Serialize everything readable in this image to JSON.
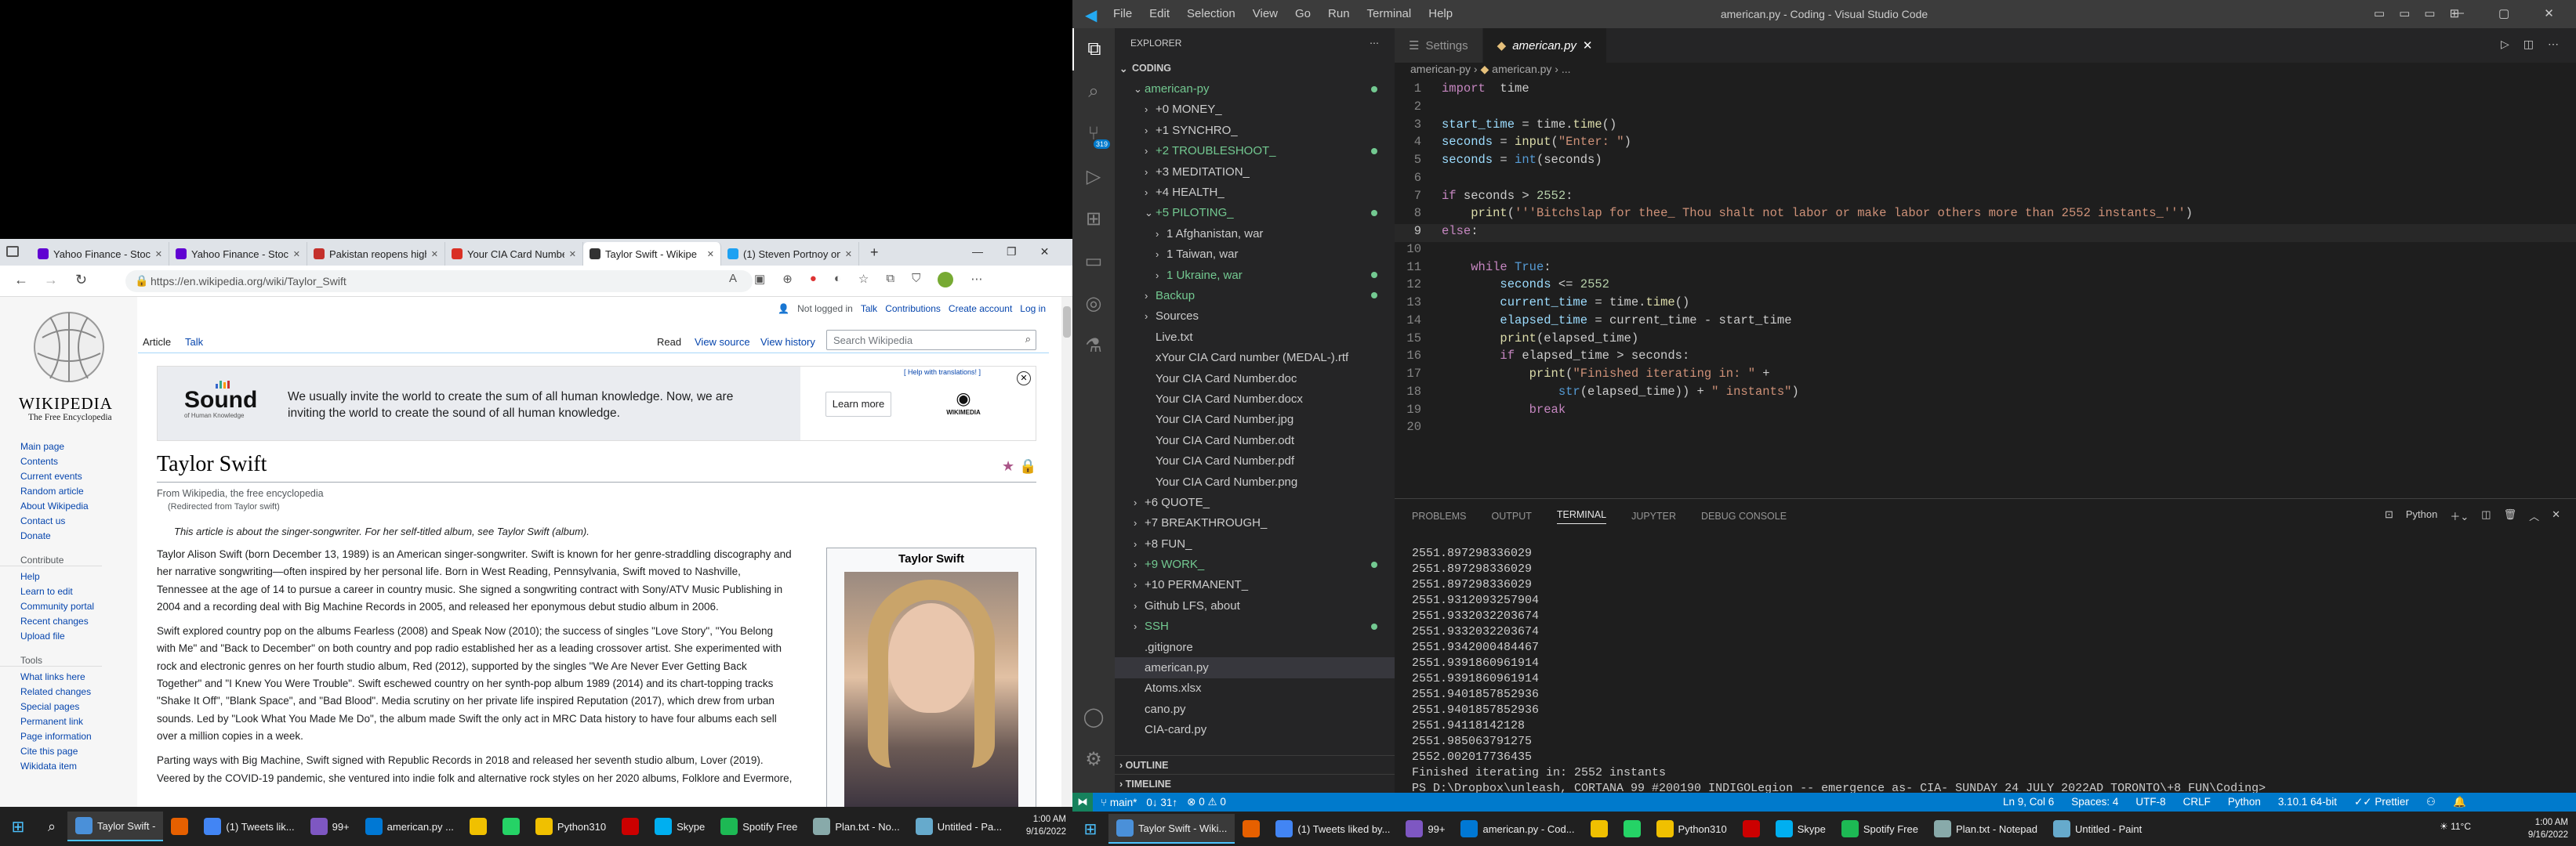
{
  "browser": {
    "tabs": [
      {
        "label": "Yahoo Finance - Stock",
        "color": "#6001d2"
      },
      {
        "label": "Yahoo Finance - Stock",
        "color": "#6001d2"
      },
      {
        "label": "Pakistan reopens high",
        "color": "#c4302b"
      },
      {
        "label": "Your CIA Card Number",
        "color": "#d93025"
      },
      {
        "label": "Taylor Swift - Wikipe",
        "color": "#333333"
      },
      {
        "label": "(1) Steven Portnoy on",
        "color": "#1da1f2"
      }
    ],
    "url": "https://en.wikipedia.org/wiki/Taylor_Swift"
  },
  "wiki": {
    "logo_title": "Wikipedia",
    "logo_tagline": "The Free Encyclopedia",
    "nav_main": [
      "Main page",
      "Contents",
      "Current events",
      "Random article",
      "About Wikipedia",
      "Contact us",
      "Donate"
    ],
    "contribute_heading": "Contribute",
    "nav_contribute": [
      "Help",
      "Learn to edit",
      "Community portal",
      "Recent changes",
      "Upload file"
    ],
    "tools_heading": "Tools",
    "nav_tools": [
      "What links here",
      "Related changes",
      "Special pages",
      "Permanent link",
      "Page information",
      "Cite this page",
      "Wikidata item"
    ],
    "user_links": {
      "not_logged": "Not logged in",
      "talk": "Talk",
      "contributions": "Contributions",
      "create": "Create account",
      "login": "Log in"
    },
    "tab_article": "Article",
    "tab_talk": "Talk",
    "tab_read": "Read",
    "tab_view_source": "View source",
    "tab_history": "View history",
    "search_placeholder": "Search Wikipedia",
    "banner": {
      "sound": "Sound",
      "sound_sub": "of Human Knowledge",
      "text": "We usually invite the world to create the sum of all human knowledge. Now, we are inviting the world to create the sound of all human knowledge.",
      "help_link": "[ Help with translations! ]",
      "learn_more": "Learn more",
      "wm": "WIKIMEDIA"
    },
    "title": "Taylor Swift",
    "from": "From Wikipedia, the free encyclopedia",
    "redirected": "(Redirected from Taylor swift)",
    "hatnote": "This article is about the singer-songwriter. For her self-titled album, see Taylor Swift (album).",
    "p1": "Taylor Alison Swift (born December 13, 1989) is an American singer-songwriter. Swift is known for her genre-straddling discography and her narrative songwriting—often inspired by her personal life. Born in West Reading, Pennsylvania, Swift moved to Nashville, Tennessee at the age of 14 to pursue a career in country music. She signed a songwriting contract with Sony/ATV Music Publishing in 2004 and a recording deal with Big Machine Records in 2005, and released her eponymous debut studio album in 2006.",
    "p2": "Swift explored country pop on the albums Fearless (2008) and Speak Now (2010); the success of singles \"Love Story\", \"You Belong with Me\" and \"Back to December\" on both country and pop radio established her as a leading crossover artist. She experimented with rock and electronic genres on her fourth studio album, Red (2012), supported by the singles \"We Are Never Ever Getting Back Together\" and \"I Knew You Were Trouble\". Swift eschewed country on her synth-pop album 1989 (2014) and its chart-topping tracks \"Shake It Off\", \"Blank Space\", and \"Bad Blood\". Media scrutiny on her private life inspired Reputation (2017), which drew from urban sounds. Led by \"Look What You Made Me Do\", the album made Swift the only act in MRC Data history to have four albums each sell over a million copies in a week.",
    "p3": "Parting ways with Big Machine, Swift signed with Republic Records in 2018 and released her seventh studio album, Lover (2019). Veered by the COVID-19 pandemic, she ventured into indie folk and alternative rock styles on her 2020 albums, Folklore and Evermore,",
    "infobox_title": "Taylor Swift"
  },
  "left_taskbar": [
    {
      "label": "Taylor Swift -",
      "color": "#4a90d9"
    },
    {
      "label": "",
      "color": "#e66000"
    },
    {
      "label": "(1) Tweets lik...",
      "color": "#4285f4"
    },
    {
      "label": "99+",
      "color": "#7e57c2"
    },
    {
      "label": "american.py ...",
      "color": "#0078d4"
    },
    {
      "label": "",
      "color": "#f0c000"
    },
    {
      "label": "",
      "color": "#25d366"
    },
    {
      "label": "Python310",
      "color": "#f0c000"
    },
    {
      "label": "",
      "color": "#cc0000"
    },
    {
      "label": "Skype",
      "color": "#00aff0"
    },
    {
      "label": "Spotify Free",
      "color": "#1db954"
    },
    {
      "label": "Plan.txt - No...",
      "color": "#8aa"
    },
    {
      "label": "Untitled - Pa...",
      "color": "#6ac"
    }
  ],
  "left_clock": {
    "time": "1:00 AM",
    "date": "9/16/2022"
  },
  "vscode": {
    "menu": [
      "File",
      "Edit",
      "Selection",
      "View",
      "Go",
      "Run",
      "Terminal",
      "Help"
    ],
    "title": "american.py - Coding - Visual Studio Code",
    "explorer_title": "EXPLORER",
    "workspace": "CODING",
    "tree": [
      {
        "label": "american-py",
        "indent": 1,
        "chev": "v",
        "color": "#73c991",
        "dot": "#73c991"
      },
      {
        "label": "+0 MONEY_",
        "indent": 2,
        "chev": ">",
        "color": "#cccccc"
      },
      {
        "label": "+1 SYNCHRO_",
        "indent": 2,
        "chev": ">",
        "color": "#cccccc"
      },
      {
        "label": "+2 TROUBLESHOOT_",
        "indent": 2,
        "chev": ">",
        "color": "#73c991",
        "dot": "#73c991"
      },
      {
        "label": "+3 MEDITATION_",
        "indent": 2,
        "chev": ">",
        "color": "#cccccc"
      },
      {
        "label": "+4 HEALTH_",
        "indent": 2,
        "chev": ">",
        "color": "#cccccc"
      },
      {
        "label": "+5 PILOTING_",
        "indent": 2,
        "chev": "v",
        "color": "#73c991",
        "dot": "#73c991"
      },
      {
        "label": "1 Afghanistan, war",
        "indent": 3,
        "chev": ">",
        "color": "#cccccc"
      },
      {
        "label": "1 Taiwan, war",
        "indent": 3,
        "chev": ">",
        "color": "#cccccc"
      },
      {
        "label": "1 Ukraine, war",
        "indent": 3,
        "chev": ">",
        "color": "#73c991",
        "dot": "#73c991"
      },
      {
        "label": "Backup",
        "indent": 2,
        "chev": ">",
        "color": "#73c991",
        "dot": "#73c991"
      },
      {
        "label": "Sources",
        "indent": 2,
        "chev": ">",
        "color": "#cccccc"
      },
      {
        "label": "Live.txt",
        "indent": 2,
        "chev": "",
        "color": "#cccccc"
      },
      {
        "label": "xYour CIA Card number (MEDAL-).rtf",
        "indent": 2,
        "chev": "",
        "color": "#cccccc"
      },
      {
        "label": "Your CIA Card Number.doc",
        "indent": 2,
        "chev": "",
        "color": "#cccccc"
      },
      {
        "label": "Your CIA Card Number.docx",
        "indent": 2,
        "chev": "",
        "color": "#cccccc"
      },
      {
        "label": "Your CIA Card Number.jpg",
        "indent": 2,
        "chev": "",
        "color": "#cccccc"
      },
      {
        "label": "Your CIA Card Number.odt",
        "indent": 2,
        "chev": "",
        "color": "#cccccc"
      },
      {
        "label": "Your CIA Card Number.pdf",
        "indent": 2,
        "chev": "",
        "color": "#cccccc"
      },
      {
        "label": "Your CIA Card Number.png",
        "indent": 2,
        "chev": "",
        "color": "#cccccc"
      },
      {
        "label": "+6 QUOTE_",
        "indent": 1,
        "chev": ">",
        "color": "#cccccc"
      },
      {
        "label": "+7 BREAKTHROUGH_",
        "indent": 1,
        "chev": ">",
        "color": "#cccccc"
      },
      {
        "label": "+8 FUN_",
        "indent": 1,
        "chev": ">",
        "color": "#cccccc"
      },
      {
        "label": "+9 WORK_",
        "indent": 1,
        "chev": ">",
        "color": "#73c991",
        "dot": "#73c991"
      },
      {
        "label": "+10 PERMANENT_",
        "indent": 1,
        "chev": ">",
        "color": "#cccccc"
      },
      {
        "label": "Github LFS, about",
        "indent": 1,
        "chev": ">",
        "color": "#cccccc"
      },
      {
        "label": "SSH",
        "indent": 1,
        "chev": ">",
        "color": "#73c991",
        "dot": "#73c991"
      },
      {
        "label": ".gitignore",
        "indent": 1,
        "chev": "",
        "color": "#cccccc"
      },
      {
        "label": "american.py",
        "indent": 1,
        "chev": "",
        "color": "#cccccc",
        "selected": true
      },
      {
        "label": "Atoms.xlsx",
        "indent": 1,
        "chev": "",
        "color": "#cccccc"
      },
      {
        "label": "cano.py",
        "indent": 1,
        "chev": "",
        "color": "#cccccc"
      },
      {
        "label": "CIA-card.py",
        "indent": 1,
        "chev": "",
        "color": "#cccccc"
      }
    ],
    "outline": "OUTLINE",
    "timeline": "TIMELINE",
    "tab_settings": "Settings",
    "tab_file": "american.py",
    "crumb_folder": "american-py",
    "crumb_file": "american.py",
    "crumb_more": "...",
    "code": [
      [
        [
          "kw",
          "import"
        ],
        [
          "",
          "  time"
        ]
      ],
      [],
      [
        [
          "var",
          "start_time"
        ],
        [
          "",
          " = time."
        ],
        [
          "fn",
          "time"
        ],
        [
          "",
          "()"
        ]
      ],
      [
        [
          "var",
          "seconds"
        ],
        [
          "",
          " = "
        ],
        [
          "fn",
          "input"
        ],
        [
          "",
          "("
        ],
        [
          "str",
          "\"Enter: \""
        ],
        [
          "",
          ")"
        ]
      ],
      [
        [
          "var",
          "seconds"
        ],
        [
          "",
          " = "
        ],
        [
          "bl",
          "int"
        ],
        [
          "",
          "(seconds)"
        ]
      ],
      [],
      [
        [
          "kw",
          "if"
        ],
        [
          "",
          " seconds > "
        ],
        [
          "num",
          "2552"
        ],
        [
          "",
          ":"
        ]
      ],
      [
        [
          "",
          "    "
        ],
        [
          "fn",
          "print"
        ],
        [
          "",
          "("
        ],
        [
          "str",
          "'''Bitchslap for thee_ Thou shalt not labor or make labor others more than 2552 instants_'''"
        ],
        [
          "",
          ")"
        ]
      ],
      [
        [
          "kw",
          "else"
        ],
        [
          "",
          ":"
        ]
      ],
      [],
      [
        [
          "",
          "    "
        ],
        [
          "kw",
          "while"
        ],
        [
          "",
          " "
        ],
        [
          "bl",
          "True"
        ],
        [
          "",
          ":"
        ]
      ],
      [
        [
          "",
          "        "
        ],
        [
          "var",
          "seconds"
        ],
        [
          "",
          " <= "
        ],
        [
          "num",
          "2552"
        ]
      ],
      [
        [
          "",
          "        "
        ],
        [
          "var",
          "current_time"
        ],
        [
          "",
          " = time."
        ],
        [
          "fn",
          "time"
        ],
        [
          "",
          "()"
        ]
      ],
      [
        [
          "",
          "        "
        ],
        [
          "var",
          "elapsed_time"
        ],
        [
          "",
          " = current_time - start_time"
        ]
      ],
      [
        [
          "",
          "        "
        ],
        [
          "fn",
          "print"
        ],
        [
          "",
          "(elapsed_time)"
        ]
      ],
      [
        [
          "",
          "        "
        ],
        [
          "kw",
          "if"
        ],
        [
          "",
          " elapsed_time > seconds:"
        ]
      ],
      [
        [
          "",
          "            "
        ],
        [
          "fn",
          "print"
        ],
        [
          "",
          "("
        ],
        [
          "str",
          "\"Finished iterating in: \""
        ],
        [
          "",
          " +"
        ]
      ],
      [
        [
          "",
          "                "
        ],
        [
          "bl",
          "str"
        ],
        [
          "",
          "(elapsed_time)) + "
        ],
        [
          "str",
          "\" instants\""
        ],
        [
          "",
          ")"
        ]
      ],
      [
        [
          "",
          "            "
        ],
        [
          "kw",
          "break"
        ]
      ],
      []
    ],
    "panel_tabs": [
      "PROBLEMS",
      "OUTPUT",
      "TERMINAL",
      "JUPYTER",
      "DEBUG CONSOLE"
    ],
    "terminal_lang": "Python",
    "terminal_lines": [
      "2551.897298336029",
      "2551.897298336029",
      "2551.897298336029",
      "2551.9312093257904",
      "2551.9332032203674",
      "2551.9332032203674",
      "2551.9342000484467",
      "2551.9391860961914",
      "2551.9391860961914",
      "2551.9401857852936",
      "2551.9401857852936",
      "2551.94118142128",
      "2551.985063791275",
      "2552.002017736435",
      "Finished iterating in: 2552 instants",
      "PS D:\\Dropbox\\unleash, CORTANA 99 #200190 INDIGOLegion -- emergence as- CIA- SUNDAY 24 JULY 2022AD TORONTO\\+8 FUN\\Coding> "
    ],
    "status": {
      "branch": "main*",
      "sync": "0↓ 31↑",
      "errors": "0",
      "warnings": "0",
      "position": "Ln 9, Col 6",
      "spaces": "Spaces: 4",
      "encoding": "UTF-8",
      "eol": "CRLF",
      "language": "Python",
      "interpreter": "3.10.1 64-bit",
      "prettier": "Prettier"
    }
  },
  "right_taskbar": [
    {
      "label": "Taylor Swift - Wiki...",
      "color": "#4a90d9"
    },
    {
      "label": "",
      "color": "#e66000"
    },
    {
      "label": "(1) Tweets liked by...",
      "color": "#4285f4"
    },
    {
      "label": "99+",
      "color": "#7e57c2"
    },
    {
      "label": "american.py - Cod...",
      "color": "#0078d4"
    },
    {
      "label": "",
      "color": "#f0c000"
    },
    {
      "label": "",
      "color": "#25d366"
    },
    {
      "label": "Python310",
      "color": "#f0c000"
    },
    {
      "label": "",
      "color": "#cc0000"
    },
    {
      "label": "Skype",
      "color": "#00aff0"
    },
    {
      "label": "Spotify Free",
      "color": "#1db954"
    },
    {
      "label": "Plan.txt - Notepad",
      "color": "#8aa"
    },
    {
      "label": "Untitled - Paint",
      "color": "#6ac"
    }
  ],
  "right_clock": {
    "weather": "11°C",
    "time": "1:00 AM",
    "date": "9/16/2022"
  }
}
